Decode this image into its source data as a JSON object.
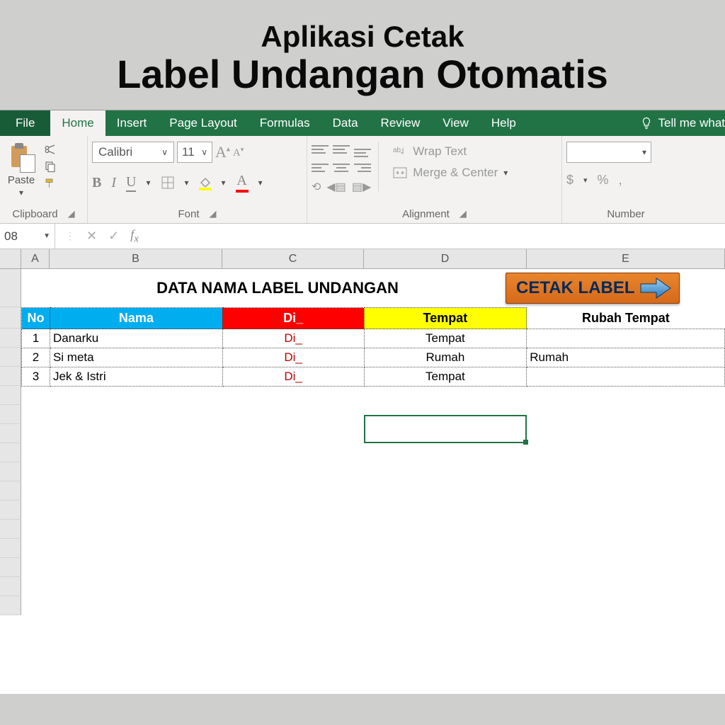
{
  "hero": {
    "sub": "Aplikasi Cetak",
    "title": "Label Undangan Otomatis"
  },
  "tabs": {
    "file": "File",
    "home": "Home",
    "insert": "Insert",
    "pageLayout": "Page Layout",
    "formulas": "Formulas",
    "data": "Data",
    "review": "Review",
    "view": "View",
    "help": "Help",
    "tell": "Tell me what"
  },
  "ribbon": {
    "paste": "Paste",
    "clipboard": "Clipboard",
    "fontName": "Calibri",
    "fontSize": "11",
    "fontGroup": "Font",
    "wrap": "Wrap Text",
    "merge": "Merge & Center",
    "alignment": "Alignment",
    "number": "Number",
    "currency": "$",
    "percent": "%",
    "comma": ","
  },
  "nameBox": "08",
  "columns": {
    "A": "A",
    "B": "B",
    "C": "C",
    "D": "D",
    "E": "E"
  },
  "sheet": {
    "title": "DATA NAMA LABEL UNDANGAN",
    "cetak": "CETAK LABEL",
    "headers": {
      "no": "No",
      "nama": "Nama",
      "di": "Di_",
      "tempat": "Tempat",
      "rubah": "Rubah Tempat"
    },
    "rows": [
      {
        "no": "1",
        "nama": "Danarku",
        "di": "Di_",
        "tempat": "Tempat",
        "rubah": ""
      },
      {
        "no": "2",
        "nama": "Si meta",
        "di": "Di_",
        "tempat": "Rumah",
        "rubah": "Rumah"
      },
      {
        "no": "3",
        "nama": "Jek & Istri",
        "di": "Di_",
        "tempat": "Tempat",
        "rubah": ""
      }
    ]
  }
}
